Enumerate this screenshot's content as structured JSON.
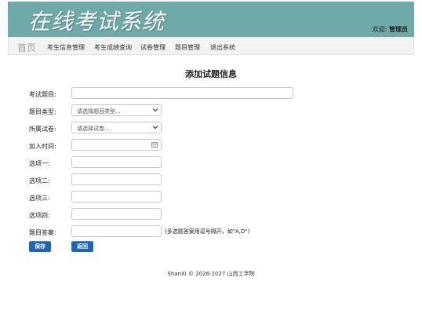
{
  "header": {
    "logo_text": "在线考试系统",
    "welcome_prefix": "欢迎:",
    "user": "管理员"
  },
  "nav": {
    "home": "首页",
    "items": [
      "考生信息管理",
      "考生成绩查询",
      "试卷管理",
      "题目管理",
      "退出系统"
    ]
  },
  "form": {
    "title": "添加试题信息",
    "labels": [
      "考试题目:",
      "题目类型:",
      "所属试卷:",
      "加入时间:",
      "选项一:",
      "选项二:",
      "选项三:",
      "选项四:",
      "题目答案:"
    ],
    "question_type_placeholder": "请选择题目类型...",
    "paper_placeholder": "请选择试卷...",
    "answer_hint": "(多选题答案用逗号隔开，如\"A,D\")",
    "save_label": "保存",
    "back_label": "返回"
  },
  "footer": {
    "text": "ShanXi © 2026-2027 山西工学院"
  },
  "colors": {
    "header_bg": "#6fa9a9",
    "button_bg": "#1f64b4"
  }
}
